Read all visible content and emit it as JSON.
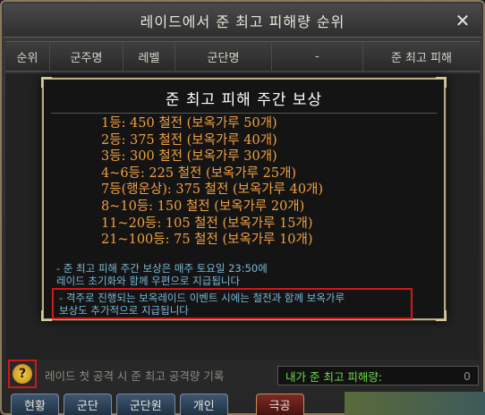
{
  "window": {
    "title": "레이드에서 준 최고 피해량 순위",
    "close": "✕"
  },
  "table": {
    "columns": [
      "순위",
      "군주명",
      "레벨",
      "군단명",
      "-",
      "준 최고 피해"
    ]
  },
  "popup": {
    "title": "준 최고 피해 주간 보상",
    "rewards": [
      "1등: 450 철전 (보옥가루 50개)",
      "2등: 375 철전 (보옥가루 40개)",
      "3등: 300 철전 (보옥가루 30개)",
      "4~6등: 225 철전 (보옥가루 25개)",
      "7등(행운상): 375 철전 (보옥가루 40개)",
      "8~10등: 150 철전 (보옥가루 20개)",
      "11~20등: 105 철전 (보옥가루 15개)",
      "21~100등: 75 철전 (보옥가루 10개)"
    ],
    "notice_line1": "- 준 최고 피해 주간 보상은 매주 토요일 23:50에",
    "notice_line2": "레이드 초기화와 함께 우편으로 지급됩니다",
    "notice_highlight_line1": "- 격주로 진행되는 보옥레이드 이벤트 시에는 철전과 함께 보옥가루",
    "notice_highlight_line2": "보상도 추가적으로 지급됩니다"
  },
  "footer": {
    "help_icon": "?",
    "record_label": "레이드 첫 공격 시 준 최고 공격량 기록",
    "my_damage_label": "내가 준 최고 피해량:",
    "my_damage_value": "0"
  },
  "tabs": [
    "현황",
    "군단",
    "군단원",
    "개인",
    "극공"
  ],
  "active_tab": "극공"
}
